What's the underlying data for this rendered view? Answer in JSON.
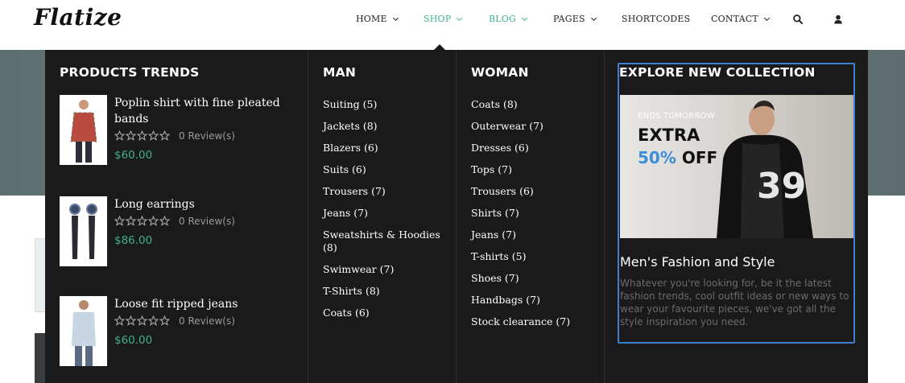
{
  "header": {
    "logo": "Flatize",
    "nav": [
      {
        "label": "HOME",
        "active": false
      },
      {
        "label": "SHOP",
        "active": true
      },
      {
        "label": "BLOG",
        "active": true
      },
      {
        "label": "PAGES",
        "active": false
      },
      {
        "label": "SHORTCODES",
        "active": false
      },
      {
        "label": "CONTACT",
        "active": false
      }
    ],
    "icons": [
      "search-icon",
      "user-icon"
    ]
  },
  "mega_menu": {
    "trends": {
      "title": "PRODUCTS TRENDS",
      "products": [
        {
          "name": "Poplin shirt with fine pleated bands",
          "reviews": "0 Review(s)",
          "price": "$60.00",
          "rating": 0
        },
        {
          "name": "Long earrings",
          "reviews": "0 Review(s)",
          "price": "$86.00",
          "rating": 0
        },
        {
          "name": "Loose fit ripped jeans",
          "reviews": "0 Review(s)",
          "price": "$60.00",
          "rating": 0
        }
      ]
    },
    "man": {
      "title": "MAN",
      "items": [
        "Suiting (5)",
        "Jackets (8)",
        "Blazers (6)",
        "Suits (6)",
        "Trousers (7)",
        "Jeans (7)",
        "Sweatshirts & Hoodies (8)",
        "Swimwear (7)",
        "T-Shirts (8)",
        "Coats (6)"
      ]
    },
    "woman": {
      "title": "WOMAN",
      "items": [
        "Coats (8)",
        "Outerwear (7)",
        "Dresses (6)",
        "Tops (7)",
        "Trousers (6)",
        "Shirts (7)",
        "Jeans (7)",
        "T-shirts (5)",
        "Shoes (7)",
        "Handbags (7)",
        "Stock clearance (7)"
      ]
    },
    "explore": {
      "title": "EXPLORE NEW COLLECTION",
      "promo_ends": "ENDS TOMORROW",
      "promo_extra": "EXTRA",
      "promo_pct": "50%",
      "promo_off": "OFF",
      "subtitle": "Men's Fashion and Style",
      "description": "Whatever you're looking for, be it the latest fashion trends, cool outfit ideas or new ways to wear your favourite pieces, we've got all the style inspiration you need."
    }
  },
  "colors": {
    "accent": "#3fb08f",
    "menu_bg": "#1a1a1a",
    "highlight_border": "#3b7fd0",
    "promo_blue": "#3a8fd8"
  }
}
